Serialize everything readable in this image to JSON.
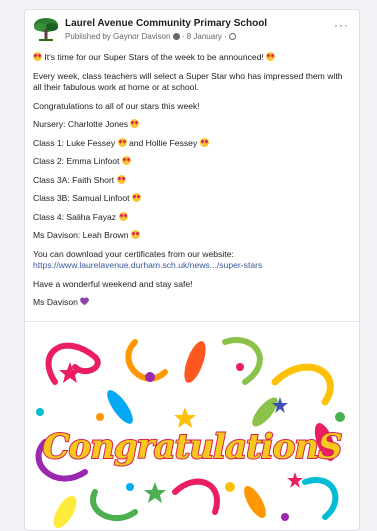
{
  "post": {
    "page_name": "Laurel Avenue Community Primary School",
    "published_by": "Published by Gaynor Davison",
    "date": "8 January",
    "more_label": "···"
  },
  "body": {
    "intro": "It's time for our Super Stars of the week to be announced!",
    "explain": "Every week, class teachers will select a Super Star who has impressed them with all their fabulous work at home or at school.",
    "congrats_line": "Congratulations to all of our stars this week!",
    "nursery": "Nursery: Charlotte Jones",
    "class1": "Class 1: Luke Fessey",
    "class1_and": "and Hollie Fessey",
    "class2": "Class 2: Emma Linfoot",
    "class3a": "Class 3A: Faith Short",
    "class3b": "Class 3B: Samual Linfoot",
    "class4": "Class 4: Saliha Fayaz",
    "ms_davison": "Ms Davison: Leah Brown",
    "download": "You can download your certificates from our website:",
    "url": "https://www.laurelavenue.durham.sch.uk/news.../super-stars",
    "weekend": "Have a wonderful weekend and stay safe!",
    "signoff": "Ms Davison"
  },
  "image": {
    "banner_text": "CongratulationS"
  },
  "colors": {
    "link": "#385898",
    "meta": "#65676b",
    "emoji_face": "#f6c633",
    "heart": "#8e44ad",
    "banner_fill": "#f7c81e",
    "banner_stroke": "#d6234b"
  },
  "icons": {
    "avatar": "tree-logo-icon",
    "emoji": "heart-eyes-emoji-icon",
    "heart": "purple-heart-icon",
    "verified": "info-dot-icon",
    "privacy": "globe-icon",
    "more": "ellipsis-icon"
  }
}
